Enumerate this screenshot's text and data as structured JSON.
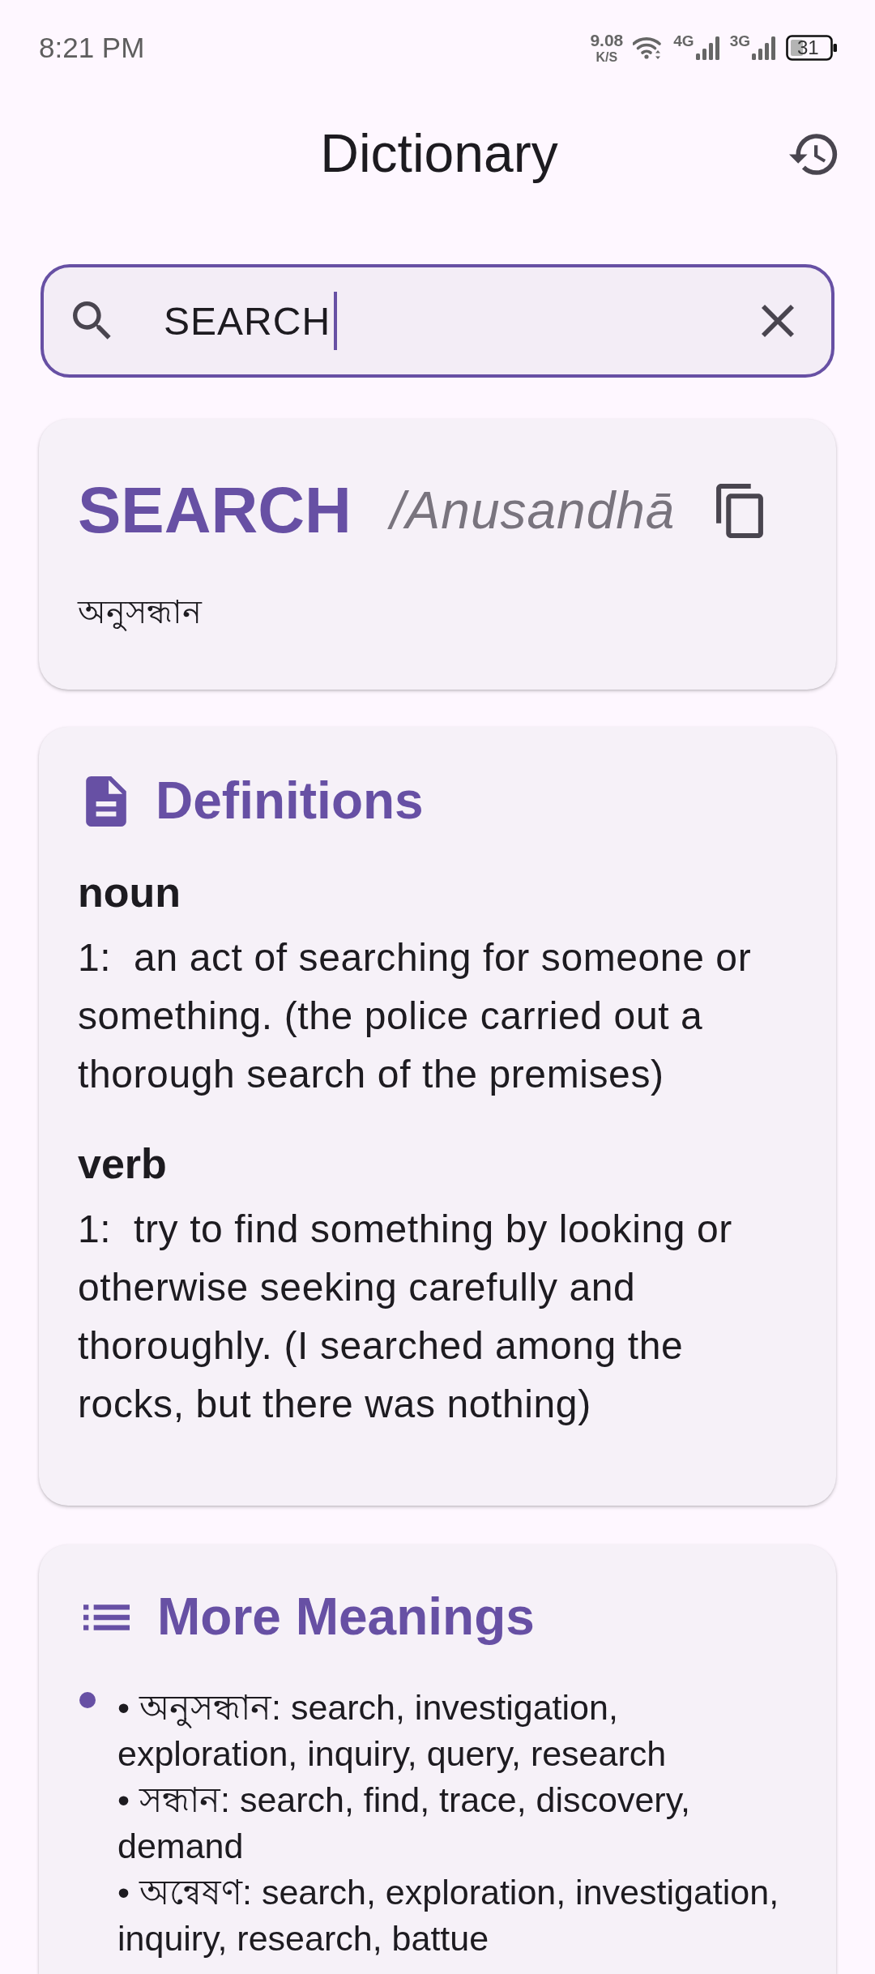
{
  "status_bar": {
    "time": "8:21 PM",
    "net_speed": {
      "value": "9.08",
      "unit": "K/S"
    },
    "networks": [
      {
        "type": "4G"
      },
      {
        "type": "3G"
      }
    ],
    "battery": {
      "percent": "31"
    }
  },
  "app_bar": {
    "title": "Dictionary"
  },
  "search": {
    "value": "SEARCH",
    "focused": true
  },
  "word_card": {
    "word": "SEARCH",
    "pronunciation": "/Anusandhā",
    "translation": "অনুসন্ধান"
  },
  "definitions": {
    "title": "Definitions",
    "groups": [
      {
        "part_of_speech": "noun",
        "senses": [
          "1:  an act of searching for someone or something. (the police carried out a thorough search of the premises)"
        ]
      },
      {
        "part_of_speech": "verb",
        "senses": [
          "1:  try to find something by looking or otherwise seeking carefully and thoroughly. (I searched among the rocks, but there was nothing)"
        ]
      }
    ]
  },
  "more_meanings": {
    "title": "More Meanings",
    "items": [
      {
        "lines": [
          "• অনুসন্ধান: search, investigation, exploration, inquiry, query, research",
          "• সন্ধান: search, find, trace, discovery, demand",
          "• অন্বেষণ: search, exploration, investigation, inquiry, research, battue"
        ]
      }
    ]
  }
}
